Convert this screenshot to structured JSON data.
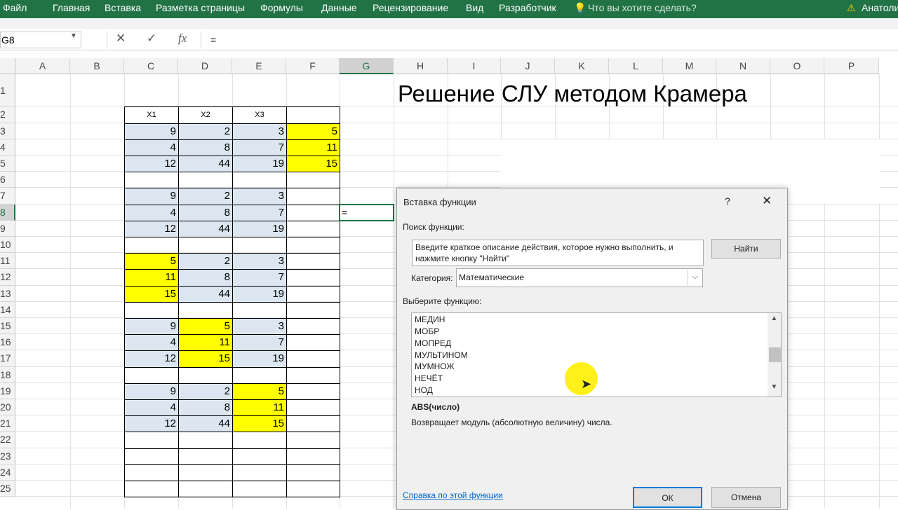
{
  "ribbon": {
    "tabs": [
      "Файл",
      "Главная",
      "Вставка",
      "Разметка страницы",
      "Формулы",
      "Данные",
      "Рецензирование",
      "Вид",
      "Разработчик"
    ],
    "tell_me": "Что вы хотите сделать?",
    "user": "Анатоли"
  },
  "formula_bar": {
    "name_box": "G8",
    "formula": "=",
    "fx_label": "fx"
  },
  "columns": [
    "A",
    "B",
    "C",
    "D",
    "E",
    "F",
    "G",
    "H",
    "I",
    "J",
    "K",
    "L",
    "M",
    "N",
    "O",
    "P"
  ],
  "rows": [
    "1",
    "2",
    "3",
    "4",
    "5",
    "6",
    "7",
    "8",
    "9",
    "10",
    "11",
    "12",
    "13",
    "14",
    "15",
    "16",
    "17",
    "18",
    "19",
    "20",
    "21",
    "22",
    "23",
    "24",
    "25"
  ],
  "headers": [
    "X1",
    "X2",
    "X3"
  ],
  "matrix_a": [
    [
      9,
      2,
      3
    ],
    [
      4,
      8,
      7
    ],
    [
      12,
      44,
      19
    ]
  ],
  "vector_b": [
    5,
    11,
    15
  ],
  "matrix_1": [
    [
      9,
      2,
      3
    ],
    [
      4,
      8,
      7
    ],
    [
      12,
      44,
      19
    ]
  ],
  "matrix_2": [
    [
      5,
      2,
      3
    ],
    [
      11,
      8,
      7
    ],
    [
      15,
      44,
      19
    ]
  ],
  "matrix_3": [
    [
      9,
      5,
      3
    ],
    [
      4,
      11,
      7
    ],
    [
      12,
      15,
      19
    ]
  ],
  "matrix_4": [
    [
      9,
      2,
      5
    ],
    [
      4,
      8,
      11
    ],
    [
      12,
      44,
      15
    ]
  ],
  "active_cell_value": "=",
  "sheet_title": "Решение СЛУ методом Крамера",
  "dialog": {
    "title": "Вставка функции",
    "help": "?",
    "close": "✕",
    "search_label": "Поиск функции:",
    "search_text": "Введите краткое описание действия, которое нужно выполнить, и\nнажмите кнопку \"Найти\"",
    "find_button": "Найти",
    "category_label": "Категория:",
    "category_value": "Математические",
    "choose_label": "Выберите функцию:",
    "functions": [
      "МЕДИН",
      "МОБР",
      "МОПРЕД",
      "МУЛЬТИНОМ",
      "МУМНОЖ",
      "НЕЧЁТ",
      "НОД"
    ],
    "signature": "ABS(число)",
    "description": "Возвращает модуль (абсолютную величину) числа.",
    "help_link": "Справка по этой функции",
    "ok": "ОК",
    "cancel": "Отмена"
  }
}
